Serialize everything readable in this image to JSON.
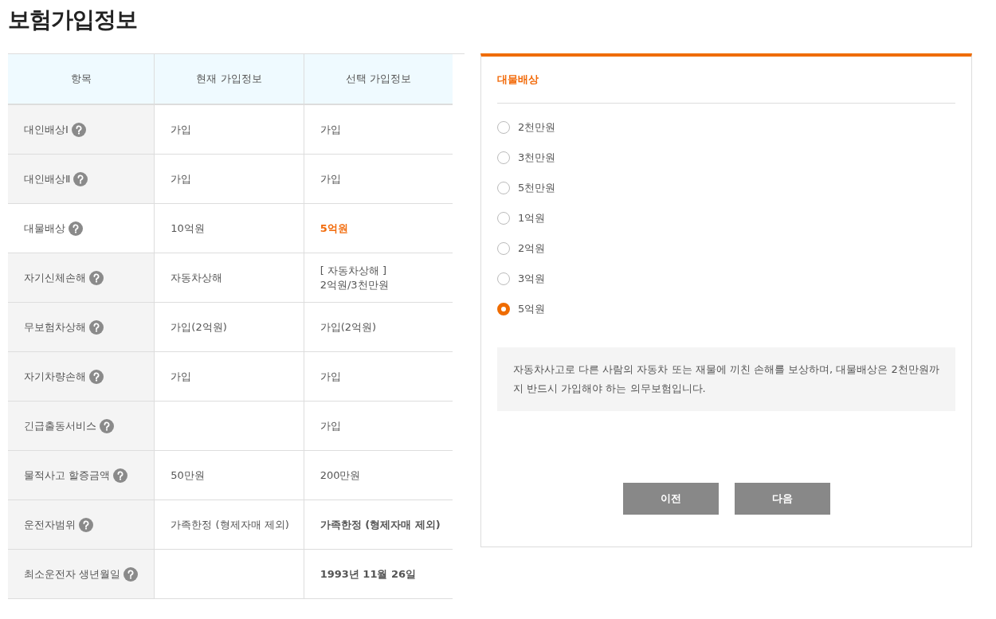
{
  "page_title": "보험가입정보",
  "table": {
    "columns": [
      "항목",
      "현재 가입정보",
      "선택 가입정보"
    ],
    "rows": [
      {
        "item": "대인배상Ⅰ",
        "current": "가입",
        "chosen": "가입",
        "selected": false,
        "bold": false
      },
      {
        "item": "대인배상Ⅱ",
        "current": "가입",
        "chosen": "가입",
        "selected": false,
        "bold": false
      },
      {
        "item": "대물배상",
        "current": "10억원",
        "chosen": "5억원",
        "selected": true,
        "bold": true
      },
      {
        "item": "자기신체손해",
        "current": "자동차상해",
        "chosen": "[   자동차상해   ]\n2억원/3천만원",
        "selected": false,
        "bold": false
      },
      {
        "item": "무보험차상해",
        "current": "가입(2억원)",
        "chosen": "가입(2억원)",
        "selected": false,
        "bold": false
      },
      {
        "item": "자기차량손해",
        "current": "가입",
        "chosen": "가입",
        "selected": false,
        "bold": false
      },
      {
        "item": "긴급출동서비스",
        "current": "",
        "chosen": "가입",
        "selected": false,
        "bold": false
      },
      {
        "item": "물적사고 할증금액",
        "current": "50만원",
        "chosen": "200만원",
        "selected": false,
        "bold": false
      },
      {
        "item": "운전자범위",
        "current": "가족한정 (형제자매 제외)",
        "chosen": "가족한정 (형제자매 제외)",
        "selected": false,
        "bold": true
      },
      {
        "item": "최소운전자 생년월일",
        "current": "",
        "chosen": "1993년 11월 26일",
        "selected": false,
        "bold": true
      }
    ]
  },
  "panel": {
    "title": "대물배상",
    "options": [
      {
        "label": "2천만원",
        "selected": false
      },
      {
        "label": "3천만원",
        "selected": false
      },
      {
        "label": "5천만원",
        "selected": false
      },
      {
        "label": "1억원",
        "selected": false
      },
      {
        "label": "2억원",
        "selected": false
      },
      {
        "label": "3억원",
        "selected": false
      },
      {
        "label": "5억원",
        "selected": true
      }
    ],
    "description": "자동차사고로 다른 사람의 자동차 또는 재물에 끼친 손해를 보상하며, 대물배상은 2천만원까지 반드시 가입해야 하는 의무보험입니다.",
    "buttons": [
      "이전",
      "다음"
    ]
  }
}
